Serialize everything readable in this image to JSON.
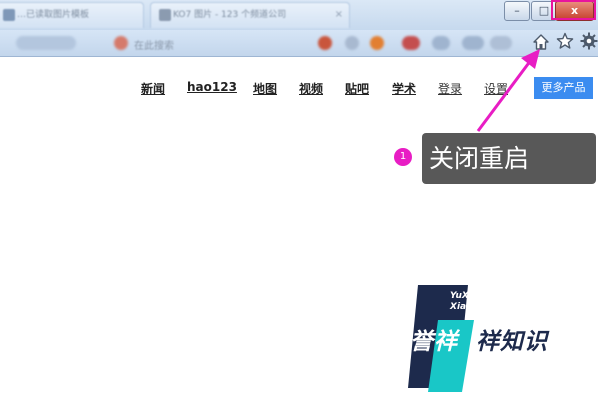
{
  "browser": {
    "tabs": [
      {
        "label": "…已读取图片模板"
      },
      {
        "label": "KO7 图片 - 123 个频道公司"
      }
    ],
    "window_controls": {
      "minimize_label": "–",
      "maximize_label": "□",
      "close_label": "x"
    },
    "toolbar": {
      "address_text": "在此搜索"
    }
  },
  "page": {
    "nav_links": [
      {
        "label": "新闻"
      },
      {
        "label": "hao123"
      },
      {
        "label": "地图"
      },
      {
        "label": "视频"
      },
      {
        "label": "贴吧"
      },
      {
        "label": "学术"
      },
      {
        "label": "登录"
      },
      {
        "label": "设置"
      }
    ],
    "more_products_label": "更多产品"
  },
  "annotation": {
    "step_number": "1",
    "callout_text": "关闭重启",
    "highlight_color": "#e8149e"
  },
  "watermark": {
    "line1": "YuXiang",
    "line2": "XiangZhiShi",
    "cn_part1": "誉祥",
    "cn_part2": "祥知识"
  },
  "colors": {
    "accent_blue": "#3b8cf0",
    "callout_bg": "#585858",
    "badge": "#e81dc4"
  }
}
